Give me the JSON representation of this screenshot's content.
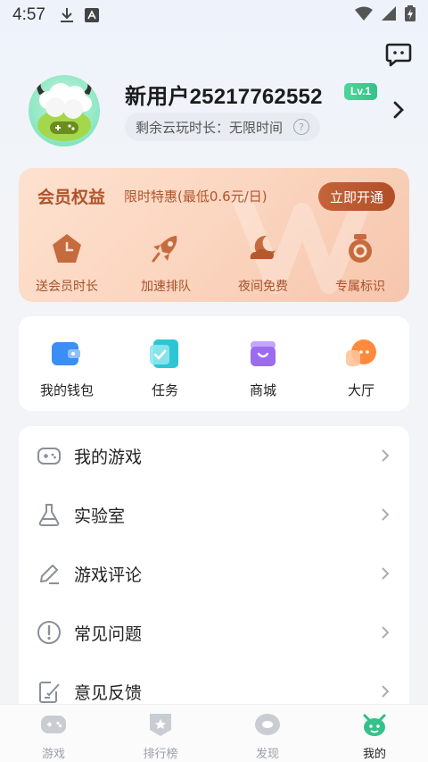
{
  "status_bar": {
    "time": "4:57"
  },
  "profile": {
    "username": "新用户25217762552",
    "level": "Lv.1",
    "remaining_label": "剩余云玩时长：无限时间"
  },
  "member": {
    "title": "会员权益",
    "promo": "限时特惠(最低0.6元/日)",
    "open_button": "立即开通",
    "benefits": [
      {
        "label": "送会员时长",
        "icon": "clock-icon"
      },
      {
        "label": "加速排队",
        "icon": "rocket-icon"
      },
      {
        "label": "夜间免费",
        "icon": "moon-cloud-icon"
      },
      {
        "label": "专属标识",
        "icon": "medal-icon"
      }
    ]
  },
  "quick_actions": [
    {
      "label": "我的钱包",
      "icon": "wallet-icon",
      "color": "#3a8ef6"
    },
    {
      "label": "任务",
      "icon": "task-icon",
      "color": "#2ec5d3"
    },
    {
      "label": "商城",
      "icon": "store-icon",
      "color": "#9b6cf0"
    },
    {
      "label": "大厅",
      "icon": "chat-bubble-icon",
      "color": "#ff8a3d"
    }
  ],
  "menu": [
    {
      "label": "我的游戏",
      "icon": "gamepad-icon"
    },
    {
      "label": "实验室",
      "icon": "flask-icon"
    },
    {
      "label": "游戏评论",
      "icon": "pencil-icon"
    },
    {
      "label": "常见问题",
      "icon": "info-icon"
    },
    {
      "label": "意见反馈",
      "icon": "feedback-icon"
    }
  ],
  "bottom_nav": [
    {
      "label": "游戏",
      "icon": "game-tab-icon",
      "active": false
    },
    {
      "label": "排行榜",
      "icon": "ranking-tab-icon",
      "active": false
    },
    {
      "label": "发现",
      "icon": "discover-tab-icon",
      "active": false
    },
    {
      "label": "我的",
      "icon": "mine-tab-icon",
      "active": true
    }
  ],
  "colors": {
    "accent_green": "#35c18a",
    "member_brown": "#b0542c",
    "menu_icon": "#8a8f98"
  }
}
